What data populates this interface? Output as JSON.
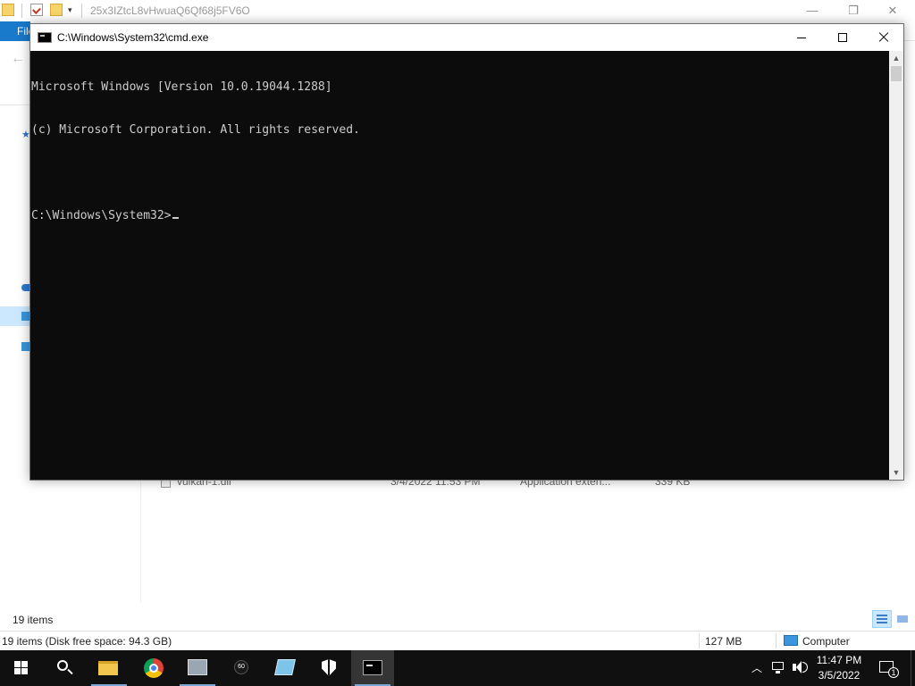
{
  "explorer": {
    "title": "25x3IZtcL8vHwuaQ6Qf68j5FV6O",
    "file_tab": "File",
    "file_row": {
      "name": "vulkan-1.dll",
      "date": "3/4/2022 11:53 PM",
      "type": "Application exten...",
      "size": "339 KB"
    },
    "items_count": "19 items",
    "status": {
      "left": "19 items (Disk free space: 94.3 GB)",
      "size": "127 MB",
      "location": "Computer"
    }
  },
  "cmd": {
    "title": "C:\\Windows\\System32\\cmd.exe",
    "lines": [
      "Microsoft Windows [Version 10.0.19044.1288]",
      "(c) Microsoft Corporation. All rights reserved.",
      "",
      "C:\\Windows\\System32>"
    ],
    "colors": {
      "background": "#0c0c0c",
      "text": "#cccccc"
    }
  },
  "taskbar": {
    "apps": [
      "start-icon",
      "search-icon",
      "file-explorer-icon",
      "chrome-icon",
      "app-icon",
      "app-icon",
      "app-icon",
      "shield-icon",
      "cmd-icon"
    ],
    "clock_time": "11:47 PM",
    "clock_date": "3/5/2022",
    "notification_count": "1",
    "colors": {
      "background": "#101010",
      "active": "#353535"
    }
  }
}
